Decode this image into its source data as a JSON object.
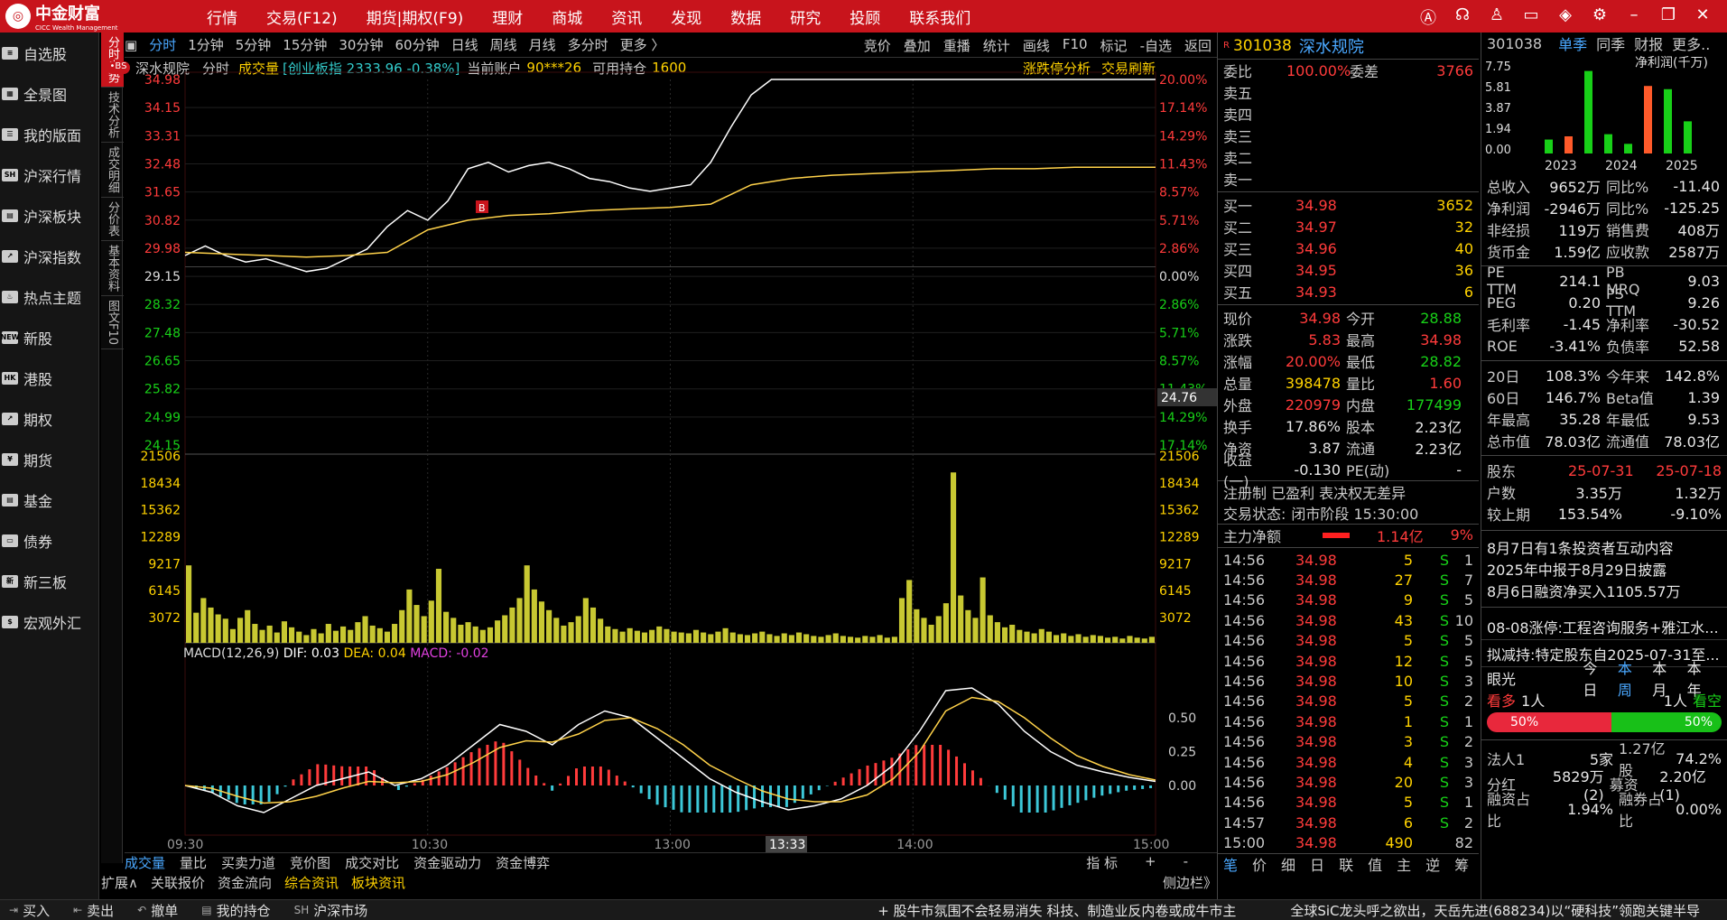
{
  "brand": {
    "name": "中金财富",
    "sub": "CICC Wealth Management"
  },
  "nav": [
    "行情",
    "交易(F12)",
    "期货|期权(F9)",
    "理财",
    "商城",
    "资讯",
    "发现",
    "数据",
    "研究",
    "投顾",
    "联系我们"
  ],
  "left_nav": [
    {
      "icon": "≡",
      "label": "自选股"
    },
    {
      "icon": "▦",
      "label": "全景图"
    },
    {
      "icon": "☰",
      "label": "我的版面"
    },
    {
      "icon": "SH",
      "label": "沪深行情"
    },
    {
      "icon": "▤",
      "label": "沪深板块"
    },
    {
      "icon": "↗",
      "label": "沪深指数"
    },
    {
      "icon": "♨",
      "label": "热点主题"
    },
    {
      "icon": "NEW",
      "label": "新股"
    },
    {
      "icon": "HK",
      "label": "港股"
    },
    {
      "icon": "↗",
      "label": "期权"
    },
    {
      "icon": "¥",
      "label": "期货"
    },
    {
      "icon": "▤",
      "label": "基金"
    },
    {
      "icon": "▭",
      "label": "债券"
    },
    {
      "icon": "新",
      "label": "新三板"
    },
    {
      "icon": "$",
      "label": "宏观外汇"
    }
  ],
  "vertical_tabs": [
    "分时走势",
    "技术分析",
    "成交明细",
    "分价表",
    "基本资料",
    "图文F10"
  ],
  "chart_tabs": [
    "分时",
    "1分钟",
    "5分钟",
    "15分钟",
    "30分钟",
    "60分钟",
    "日线",
    "周线",
    "月线",
    "多分时",
    "更多 〉"
  ],
  "chart_tools": [
    "竞价",
    "叠加",
    "重播",
    "统计",
    "画线",
    "F10",
    "标记",
    "-自选",
    "返回"
  ],
  "chart_info": {
    "name": "深水规院",
    "mode": "分时",
    "vol_label": "成交量",
    "index": "[创业板指 2333.96 -0.38%]",
    "account": "当前账户",
    "account_id": "90***26",
    "hold_label": "可用持仓",
    "hold": "1600",
    "limit_btn": "涨跌停分析",
    "refresh_btn": "交易刷新"
  },
  "chart_data": {
    "type": "line",
    "title": "深水规院 分时",
    "prev_close": 29.15,
    "ylim": [
      24.15,
      34.98
    ],
    "price_ticks": [
      "34.98",
      "34.15",
      "33.31",
      "32.48",
      "31.65",
      "30.82",
      "29.98",
      "29.15",
      "28.32",
      "27.48",
      "26.65",
      "25.82",
      "24.99",
      "24.15"
    ],
    "pct_ticks": [
      "20.00%",
      "17.14%",
      "14.29%",
      "11.43%",
      "8.57%",
      "5.71%",
      "2.86%",
      "0.00%",
      "2.86%",
      "5.71%",
      "8.57%",
      "11.43%",
      "14.29%",
      "17.14%"
    ],
    "vol_ticks": [
      "21506",
      "18434",
      "15362",
      "12289",
      "9217",
      "6145",
      "3072"
    ],
    "time_ticks": [
      "09:30",
      "10:30",
      "13:00",
      "14:00",
      "15:00"
    ],
    "cursor_time": "13:33",
    "cursor_price": "24.76",
    "series": [
      {
        "name": "价格",
        "color": "#ffffff",
        "t": [
          0,
          5,
          10,
          15,
          20,
          25,
          30,
          35,
          40,
          45,
          50,
          55,
          60,
          65,
          70,
          75,
          80,
          85,
          90,
          95,
          100,
          105,
          110,
          115,
          120,
          125,
          130,
          135,
          140,
          145,
          150,
          155,
          160,
          165,
          170,
          175,
          180,
          185,
          190,
          195,
          200,
          205,
          210,
          215,
          220,
          225,
          230,
          235,
          240
        ],
        "values": [
          29.5,
          29.8,
          29.5,
          29.3,
          29.4,
          29.2,
          29.0,
          29.1,
          29.4,
          29.7,
          30.4,
          30.9,
          30.6,
          31.2,
          32.2,
          32.4,
          32.1,
          32.3,
          32.4,
          32.2,
          31.9,
          31.8,
          31.6,
          31.5,
          31.6,
          31.7,
          32.4,
          33.5,
          34.5,
          34.98,
          34.98,
          34.98,
          34.98,
          34.98,
          34.98,
          34.98,
          34.98,
          34.98,
          34.98,
          34.98,
          34.98,
          34.98,
          34.98,
          34.98,
          34.98,
          34.98,
          34.98,
          34.98,
          34.98
        ]
      },
      {
        "name": "均价",
        "color": "#ffd24a",
        "t": [
          0,
          10,
          20,
          30,
          40,
          50,
          60,
          70,
          80,
          90,
          100,
          110,
          120,
          130,
          140,
          150,
          160,
          170,
          180,
          190,
          200,
          210,
          220,
          230,
          240
        ],
        "values": [
          29.6,
          29.55,
          29.5,
          29.45,
          29.5,
          29.6,
          30.3,
          30.6,
          30.75,
          30.8,
          30.9,
          30.95,
          31.0,
          31.1,
          31.7,
          31.9,
          32.0,
          32.05,
          32.1,
          32.15,
          32.2,
          32.2,
          32.25,
          32.25,
          32.25
        ]
      }
    ],
    "volume_max": 21506,
    "volumes": [
      9000,
      3500,
      5200,
      4100,
      3300,
      2800,
      1600,
      2900,
      3800,
      2200,
      1500,
      2000,
      1200,
      2500,
      1800,
      1300,
      900,
      1600,
      1100,
      2200,
      1400,
      1900,
      1500,
      2400,
      3100,
      2000,
      1700,
      1300,
      2200,
      3800,
      6200,
      4400,
      3100,
      4900,
      8600,
      3600,
      2900,
      2100,
      2400,
      1900,
      1500,
      1800,
      2600,
      3200,
      4100,
      5200,
      9000,
      6200,
      4800,
      3800,
      2900,
      2000,
      2400,
      3100,
      5200,
      4100,
      2800,
      1900,
      1600,
      1300,
      1700,
      1400,
      1200,
      1500,
      1900,
      1600,
      1300,
      1200,
      1100,
      1500,
      1200,
      1000,
      1300,
      1700,
      1200,
      1000,
      900,
      1100,
      1300,
      1000,
      800,
      1100,
      900,
      1200,
      1000,
      800,
      700,
      900,
      1100,
      800,
      700,
      600,
      800,
      700,
      900,
      600,
      700,
      5200,
      7300,
      3900,
      2900,
      2100,
      3100,
      4600,
      19800,
      5500,
      3800,
      2900,
      7600,
      3200,
      2400,
      1800,
      2100,
      1500,
      1300,
      1100,
      1600,
      1300,
      900,
      1100,
      800,
      1000,
      700,
      900,
      800,
      600,
      700,
      500,
      800,
      600,
      500,
      700
    ],
    "macd": {
      "label": "MACD(12,26,9)",
      "dif": "DIF: 0.03",
      "dea": "DEA: 0.04",
      "macd": "MACD: -0.02",
      "ticks": [
        "0.50",
        "0.25",
        "0.00"
      ],
      "dif_values": [
        0,
        -0.05,
        -0.15,
        -0.2,
        -0.1,
        0,
        0.05,
        0.1,
        0.0,
        0.05,
        0.15,
        0.3,
        0.45,
        0.4,
        0.3,
        0.45,
        0.55,
        0.5,
        0.35,
        0.2,
        0.05,
        -0.05,
        -0.12,
        -0.18,
        -0.15,
        -0.1,
        0.0,
        0.15,
        0.4,
        0.7,
        0.72,
        0.6,
        0.4,
        0.25,
        0.15,
        0.1,
        0.06,
        0.03
      ],
      "dea_values": [
        0,
        -0.02,
        -0.08,
        -0.13,
        -0.12,
        -0.08,
        -0.02,
        0.03,
        0.02,
        0.03,
        0.08,
        0.17,
        0.28,
        0.33,
        0.32,
        0.38,
        0.48,
        0.5,
        0.42,
        0.3,
        0.15,
        0.05,
        -0.04,
        -0.1,
        -0.12,
        -0.12,
        -0.07,
        0.05,
        0.25,
        0.55,
        0.65,
        0.62,
        0.5,
        0.35,
        0.22,
        0.14,
        0.08,
        0.04
      ]
    }
  },
  "quote": {
    "code": "301038",
    "name": "深水规院",
    "r": "R",
    "weibi_label": "委比",
    "weibi": "100.00%",
    "weicha_label": "委差",
    "weicha": "3766",
    "sell": [
      {
        "label": "卖五",
        "price": "",
        "vol": ""
      },
      {
        "label": "卖四",
        "price": "",
        "vol": ""
      },
      {
        "label": "卖三",
        "price": "",
        "vol": ""
      },
      {
        "label": "卖二",
        "price": "",
        "vol": ""
      },
      {
        "label": "卖一",
        "price": "",
        "vol": ""
      }
    ],
    "buy": [
      {
        "label": "买一",
        "price": "34.98",
        "vol": "3652"
      },
      {
        "label": "买二",
        "price": "34.97",
        "vol": "32"
      },
      {
        "label": "买三",
        "price": "34.96",
        "vol": "40"
      },
      {
        "label": "买四",
        "price": "34.95",
        "vol": "36"
      },
      {
        "label": "买五",
        "price": "34.93",
        "vol": "6"
      }
    ],
    "stats": [
      [
        {
          "l": "现价",
          "v": "34.98",
          "c": "red"
        },
        {
          "l": "今开",
          "v": "28.88",
          "c": "green"
        }
      ],
      [
        {
          "l": "涨跌",
          "v": "5.83",
          "c": "red"
        },
        {
          "l": "最高",
          "v": "34.98",
          "c": "red"
        }
      ],
      [
        {
          "l": "涨幅",
          "v": "20.00%",
          "c": "red"
        },
        {
          "l": "最低",
          "v": "28.82",
          "c": "green"
        }
      ],
      [
        {
          "l": "总量",
          "v": "398478",
          "c": "yellow"
        },
        {
          "l": "量比",
          "v": "1.60",
          "c": "red"
        }
      ],
      [
        {
          "l": "外盘",
          "v": "220979",
          "c": "red"
        },
        {
          "l": "内盘",
          "v": "177499",
          "c": "green"
        }
      ],
      [
        {
          "l": "换手",
          "v": "17.86%",
          "c": "white"
        },
        {
          "l": "股本",
          "v": "2.23亿",
          "c": "white"
        }
      ],
      [
        {
          "l": "净资",
          "v": "3.87",
          "c": "white"
        },
        {
          "l": "流通",
          "v": "2.23亿",
          "c": "white"
        }
      ],
      [
        {
          "l": "收益(一)",
          "v": "-0.130",
          "c": "white"
        },
        {
          "l": "PE(动)",
          "v": "-",
          "c": "white"
        }
      ]
    ],
    "tags": "注册制 已盈利 表决权无差异",
    "status_label": "交易状态:",
    "status": "闭市阶段 15:30:00",
    "main_flow_label": "主力净额",
    "main_flow": "1.14亿",
    "main_flow_pct": "9%",
    "ticks": [
      [
        "14:56",
        "34.98",
        "5",
        "S",
        "1"
      ],
      [
        "14:56",
        "34.98",
        "27",
        "S",
        "7"
      ],
      [
        "14:56",
        "34.98",
        "9",
        "S",
        "5"
      ],
      [
        "14:56",
        "34.98",
        "43",
        "S",
        "10"
      ],
      [
        "14:56",
        "34.98",
        "5",
        "S",
        "5"
      ],
      [
        "14:56",
        "34.98",
        "12",
        "S",
        "5"
      ],
      [
        "14:56",
        "34.98",
        "10",
        "S",
        "3"
      ],
      [
        "14:56",
        "34.98",
        "5",
        "S",
        "2"
      ],
      [
        "14:56",
        "34.98",
        "1",
        "S",
        "1"
      ],
      [
        "14:56",
        "34.98",
        "3",
        "S",
        "2"
      ],
      [
        "14:56",
        "34.98",
        "4",
        "S",
        "3"
      ],
      [
        "14:56",
        "34.98",
        "20",
        "S",
        "3"
      ],
      [
        "14:56",
        "34.98",
        "5",
        "S",
        "1"
      ],
      [
        "14:57",
        "34.98",
        "6",
        "S",
        "2"
      ],
      [
        "15:00",
        "34.98",
        "490",
        "",
        "82"
      ]
    ],
    "bottom_tabs": [
      "笔",
      "价",
      "细",
      "日",
      "联",
      "值",
      "主",
      "逆",
      "筹"
    ]
  },
  "fin": {
    "code": "301038",
    "tabs": [
      "单季",
      "同季",
      "财报",
      "更多.."
    ],
    "chart_title": "净利润(千万)",
    "yticks": [
      "7.75",
      "5.81",
      "3.87",
      "1.94",
      "0.00"
    ],
    "years": [
      "2023",
      "2024",
      "2025"
    ],
    "bars": [
      {
        "v": 1.3,
        "c": "#18d018"
      },
      {
        "v": 1.6,
        "c": "#ff5a2a"
      },
      {
        "v": 7.7,
        "c": "#18d018"
      },
      {
        "v": 1.8,
        "c": "#18d018"
      },
      {
        "v": 0.9,
        "c": "#18d018"
      },
      {
        "v": 6.3,
        "c": "#ff5a2a"
      },
      {
        "v": 6.0,
        "c": "#18d018"
      },
      {
        "v": 3.0,
        "c": "#18d018"
      }
    ],
    "rows": [
      [
        {
          "l": "总收入",
          "v": "9652万"
        },
        {
          "l": "同比%",
          "v": "-11.40"
        }
      ],
      [
        {
          "l": "净利润",
          "v": "-2946万"
        },
        {
          "l": "同比%",
          "v": "-125.25"
        }
      ],
      [
        {
          "l": "非经损",
          "v": "119万"
        },
        {
          "l": "销售费",
          "v": "408万"
        }
      ],
      [
        {
          "l": "货币金",
          "v": "1.59亿"
        },
        {
          "l": "应收款",
          "v": "2587万"
        }
      ]
    ],
    "rows2": [
      [
        {
          "l": "PE TTM",
          "v": "214.1"
        },
        {
          "l": "PB MRQ",
          "v": "9.03"
        }
      ],
      [
        {
          "l": "PEG",
          "v": "0.20"
        },
        {
          "l": "PS TTM",
          "v": "9.26"
        }
      ],
      [
        {
          "l": "毛利率",
          "v": "-1.45"
        },
        {
          "l": "净利率",
          "v": "-30.52"
        }
      ],
      [
        {
          "l": "ROE",
          "v": "-3.41%"
        },
        {
          "l": "负债率",
          "v": "52.58"
        }
      ]
    ],
    "rows3": [
      [
        {
          "l": "20日",
          "v": "108.3%"
        },
        {
          "l": "今年来",
          "v": "142.8%"
        }
      ],
      [
        {
          "l": "60日",
          "v": "146.7%"
        },
        {
          "l": "Beta值",
          "v": "1.39"
        }
      ],
      [
        {
          "l": "年最高",
          "v": "35.28"
        },
        {
          "l": "年最低",
          "v": "9.53"
        }
      ],
      [
        {
          "l": "总市值",
          "v": "78.03亿"
        },
        {
          "l": "流通值",
          "v": "78.03亿"
        }
      ]
    ],
    "holders": {
      "label": "股东",
      "d1": "25-07-31",
      "d2": "25-07-18",
      "rows": [
        [
          {
            "l": "户数",
            "v": "3.35万"
          },
          {
            "v": "1.32万"
          }
        ],
        [
          {
            "l": "较上期",
            "v": "153.54%"
          },
          {
            "v": "-9.10%"
          }
        ]
      ]
    },
    "news": [
      "8月7日有1条投资者互动内容",
      "2025年中报于8月29日披露",
      "8月6日融资净买入1105.57万"
    ],
    "news2": [
      "08-08涨停:工程咨询服务+雅江水...",
      "拟减持:特定股东自2025-07-31至..."
    ],
    "vision": {
      "label": "眼光",
      "tabs": [
        "今日",
        "本周",
        "本月",
        "本年"
      ],
      "bull": "看多",
      "bull_n": "1人",
      "bear_n": "1人",
      "bear": "看空",
      "bull_pct": "50%",
      "bear_pct": "50%"
    },
    "extra": [
      [
        {
          "l": "法人1",
          "v": "5家"
        },
        {
          "l": "1.27亿股",
          "v": "74.2%"
        }
      ],
      [
        {
          "l": "分红",
          "v": "5829万(2)"
        },
        {
          "l": "募资",
          "v": "2.20亿(1)"
        }
      ],
      [
        {
          "l": "融资占比",
          "v": "1.94%"
        },
        {
          "l": "融券占比",
          "v": "0.00%"
        }
      ]
    ]
  },
  "bottom_chart_tabs": [
    "成交量",
    "量比",
    "买卖力道",
    "竞价图",
    "成交对比",
    "资金驱动力",
    "资金博弈"
  ],
  "bottom_chart_right": [
    "指 标",
    "+",
    "-"
  ],
  "ext_tabs": [
    "扩展∧",
    "关联报价",
    "资金流向",
    "综合资讯",
    "板块资讯"
  ],
  "sidebar_label": "侧边栏》",
  "bottom_bar": [
    {
      "icon": "⇥",
      "label": "买入"
    },
    {
      "icon": "⇤",
      "label": "卖出"
    },
    {
      "icon": "↶",
      "label": "撤单"
    },
    {
      "icon": "▤",
      "label": "我的持仓"
    },
    {
      "icon": "SH",
      "label": "沪深市场"
    }
  ],
  "ticker": "+  股牛市氛围不会轻易消失 科技、制造业反内卷或成牛市主",
  "ticker2": "全球SiC龙头呼之欲出，天岳先进(688234)以“硬科技”领跑关键半导"
}
